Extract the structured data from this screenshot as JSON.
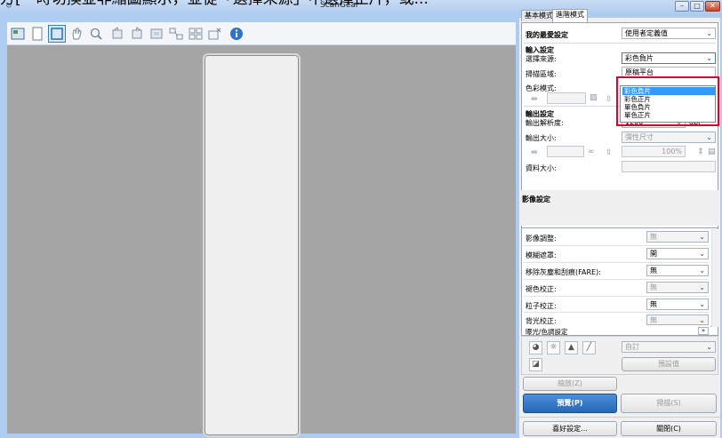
{
  "caption": "方[一時切換並非縮圖顯示，並從「選擇來源」中選擇正片，或...",
  "window": {
    "title": "ScanGear"
  },
  "tabs": [
    {
      "label": "基本模式"
    },
    {
      "label": "進階模式",
      "active": true
    }
  ],
  "favorites": {
    "label": "我的最愛設定",
    "value": "使用者定義值"
  },
  "input_settings": {
    "heading": "輸入設定",
    "source_label": "選擇來源:",
    "source_value": "彩色負片",
    "scan_area_label": "掃描區域:",
    "scan_area_value": "原稿平台",
    "color_mode_label": "色彩模式:"
  },
  "source_options": [
    {
      "label": "彩色負片",
      "highlighted": true
    },
    {
      "label": "彩色正片",
      "highlighted": false
    },
    {
      "label": "單色負片",
      "highlighted": false
    },
    {
      "label": "單色正片",
      "highlighted": false
    }
  ],
  "output_settings": {
    "heading": "輸出設定",
    "resolution_label": "輸出解析度:",
    "resolution_value": "1200",
    "resolution_unit": "dpi",
    "size_label": "輸出大小:",
    "size_value": "彈性尺寸",
    "scale_value": "100%",
    "data_size_label": "資料大小:"
  },
  "image_settings": {
    "heading": "影像設定",
    "rows": [
      {
        "label": "影像調整:",
        "value": "無",
        "enabled": false
      },
      {
        "label": "模糊遮罩:",
        "value": "開",
        "enabled": true
      },
      {
        "label": "移除灰塵和刮痕(FARE):",
        "value": "無",
        "enabled": true
      },
      {
        "label": "褪色校正:",
        "value": "無",
        "enabled": false
      },
      {
        "label": "粒子校正:",
        "value": "無",
        "enabled": true
      },
      {
        "label": "背光校正:",
        "value": "無",
        "enabled": false
      }
    ],
    "exposure_label": "曝光/色調設定"
  },
  "tone": {
    "preset_value": "自訂",
    "defaults_label": "預設值"
  },
  "buttons": {
    "zoom": "縮放(Z)",
    "preview": "預覽(P)",
    "scan": "掃描(S)",
    "preferences": "喜好設定...",
    "close": "關閉(C)"
  }
}
